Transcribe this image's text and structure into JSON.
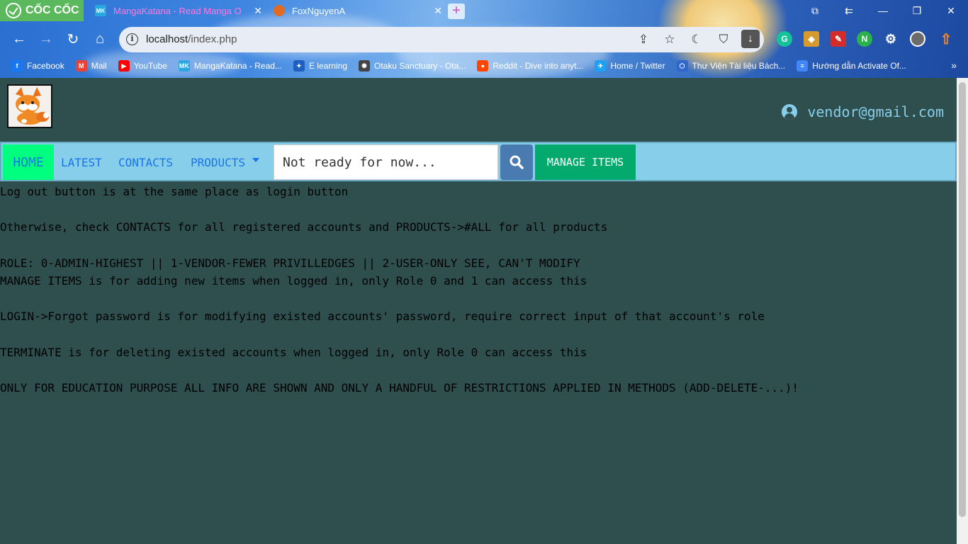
{
  "browser": {
    "brand": "CỐC CỐC",
    "tabs": [
      {
        "title": "MangaKatana - Read Manga O",
        "favicon": "MK"
      },
      {
        "title": "FoxNguyenA",
        "favicon": "fox-icon"
      }
    ],
    "url_host": "localhost",
    "url_path": "/index.php",
    "bookmarks": [
      {
        "label": "Facebook",
        "icon": "f",
        "color": "#1877f2"
      },
      {
        "label": "Mail",
        "icon": "M",
        "color": "#ea4335"
      },
      {
        "label": "YouTube",
        "icon": "▶",
        "color": "#ff0000"
      },
      {
        "label": "MangaKatana - Read...",
        "icon": "MK",
        "color": "#2aa6e0"
      },
      {
        "label": "E learning",
        "icon": "✦",
        "color": "#1f5fbf"
      },
      {
        "label": "Otaku Sanctuary - Ota...",
        "icon": "✺",
        "color": "#444444"
      },
      {
        "label": "Reddit - Dive into anyt...",
        "icon": "●",
        "color": "#ff4500"
      },
      {
        "label": "Home / Twitter",
        "icon": "✈",
        "color": "#1da1f2"
      },
      {
        "label": "Thư Viện Tài liệu Bách...",
        "icon": "⬡",
        "color": "#3366cc"
      },
      {
        "label": "Hướng dẫn Activate Of...",
        "icon": "≡",
        "color": "#4285f4"
      }
    ],
    "extensions": [
      {
        "name": "grammarly-icon",
        "glyph": "G",
        "color": "#15c39a"
      },
      {
        "name": "game-extension-icon",
        "glyph": "◆",
        "color": "#d69a2d"
      },
      {
        "name": "pen-extension-icon",
        "glyph": "✎",
        "color": "#d42b2b"
      },
      {
        "name": "n-extension-icon",
        "glyph": "N",
        "color": "#2bb24c"
      },
      {
        "name": "puzzle-icon",
        "glyph": "⚙",
        "color": "#1a4fa0"
      }
    ]
  },
  "site": {
    "user_email": "vendor@gmail.com",
    "nav": {
      "home": "HOME",
      "latest": "LATEST",
      "contacts": "CONTACTS",
      "products": "PRODUCTS"
    },
    "search_placeholder": "Not ready for now...",
    "manage_label": "MANAGE ITEMS",
    "info_lines": [
      "Log out button is at the same place as login button",
      "",
      "Otherwise, check CONTACTS for all registered accounts and PRODUCTS->#ALL for all products",
      "",
      "ROLE: 0-ADMIN-HIGHEST || 1-VENDOR-FEWER PRIVILLEDGES || 2-USER-ONLY SEE, CAN'T MODIFY",
      "MANAGE ITEMS is for adding new items when logged in, only Role 0 and 1 can access this",
      "",
      "LOGIN->Forgot password is for modifying existed accounts' password, require correct input of that account's role",
      "",
      "TERMINATE is for deleting existed accounts when logged in, only Role 0 can access this",
      "",
      "ONLY FOR EDUCATION PURPOSE ALL INFO ARE SHOWN AND ONLY A HANDFUL OF RESTRICTIONS APPLIED IN METHODS (ADD-DELETE-...)!"
    ]
  }
}
